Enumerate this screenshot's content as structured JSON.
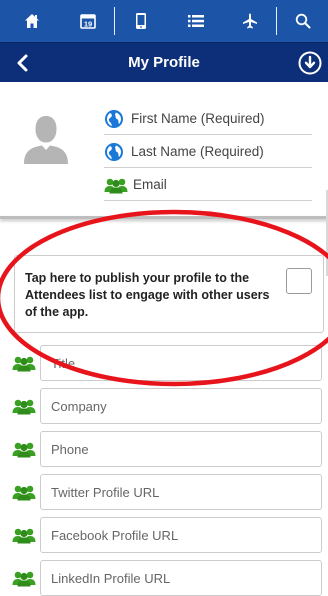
{
  "nav": {
    "icons": [
      "home-icon",
      "calendar-icon",
      "phone-icon",
      "list-icon",
      "airplane-icon",
      "search-icon"
    ],
    "calendar_day": "19"
  },
  "header": {
    "title": "My Profile"
  },
  "profile": {
    "first_name_placeholder": "First Name (Required)",
    "last_name_placeholder": "Last Name (Required)",
    "email_placeholder": "Email"
  },
  "publish": {
    "text": "Tap here to publish your profile to the Attendees list to engage with other users of the app.",
    "checked": false
  },
  "fields": [
    {
      "name": "title",
      "placeholder": "Title"
    },
    {
      "name": "company",
      "placeholder": "Company"
    },
    {
      "name": "phone",
      "placeholder": "Phone"
    },
    {
      "name": "twitter",
      "placeholder": "Twitter Profile URL"
    },
    {
      "name": "facebook",
      "placeholder": "Facebook Profile URL"
    },
    {
      "name": "linkedin",
      "placeholder": "LinkedIn Profile URL"
    }
  ],
  "colors": {
    "nav_bg": "#1c55a8",
    "title_bg": "#0d2f7a",
    "globe_icon": "#1a78d8",
    "people_icon": "#3aa022",
    "annotation": "#e8141c"
  }
}
